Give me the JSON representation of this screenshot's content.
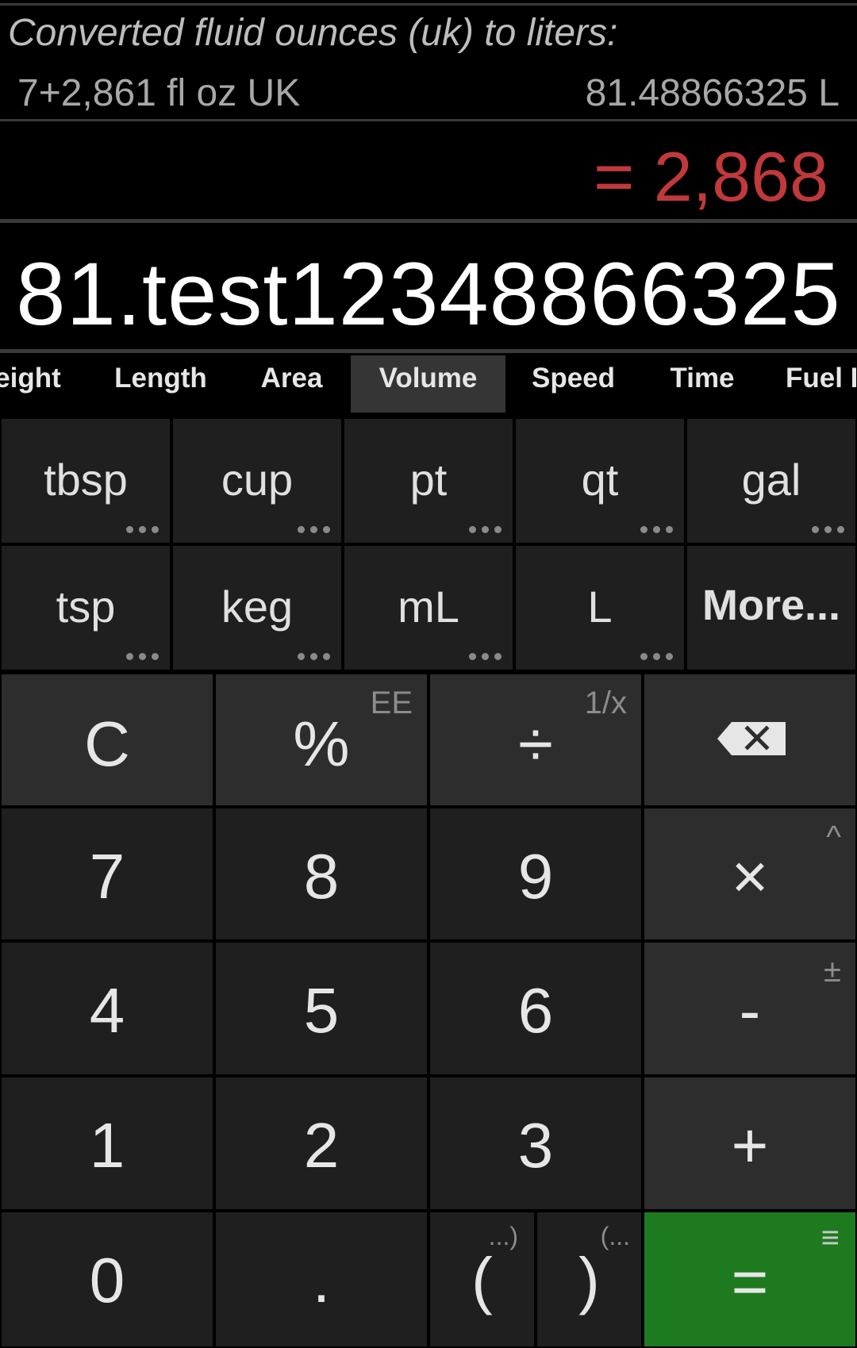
{
  "history": {
    "title": "Converted fluid ounces (uk) to liters:",
    "expression": "7+2,861 fl oz UK",
    "result": "81.48866325 L"
  },
  "preview": "= 2,868",
  "display": "81.test12348866325",
  "tabs": [
    {
      "label": "eight",
      "active": false
    },
    {
      "label": "Length",
      "active": false
    },
    {
      "label": "Area",
      "active": false
    },
    {
      "label": "Volume",
      "active": true
    },
    {
      "label": "Speed",
      "active": false
    },
    {
      "label": "Time",
      "active": false
    },
    {
      "label": "Fuel I",
      "active": false
    }
  ],
  "units": [
    {
      "label": "tbsp"
    },
    {
      "label": "cup"
    },
    {
      "label": "pt"
    },
    {
      "label": "qt"
    },
    {
      "label": "gal"
    },
    {
      "label": "tsp"
    },
    {
      "label": "keg"
    },
    {
      "label": "mL"
    },
    {
      "label": "L"
    },
    {
      "label": "More..."
    }
  ],
  "keys": {
    "clear": "C",
    "percent": "%",
    "percent_alt": "EE",
    "divide": "÷",
    "divide_alt": "1/x",
    "backspace_icon": "backspace-icon",
    "seven": "7",
    "eight": "8",
    "nine": "9",
    "multiply": "×",
    "multiply_alt": "^",
    "four": "4",
    "five": "5",
    "six": "6",
    "minus": "-",
    "minus_alt": "±",
    "one": "1",
    "two": "2",
    "three": "3",
    "plus": "+",
    "zero": "0",
    "dot": ".",
    "open_paren": "(",
    "open_paren_alt": "...)",
    "close_paren": ")",
    "close_paren_alt": "(...",
    "equals": "=",
    "equals_alt": "≡"
  },
  "colors": {
    "preview": "#c0393b",
    "equals_key": "#1e7a1e",
    "active_tab": "#353535"
  }
}
